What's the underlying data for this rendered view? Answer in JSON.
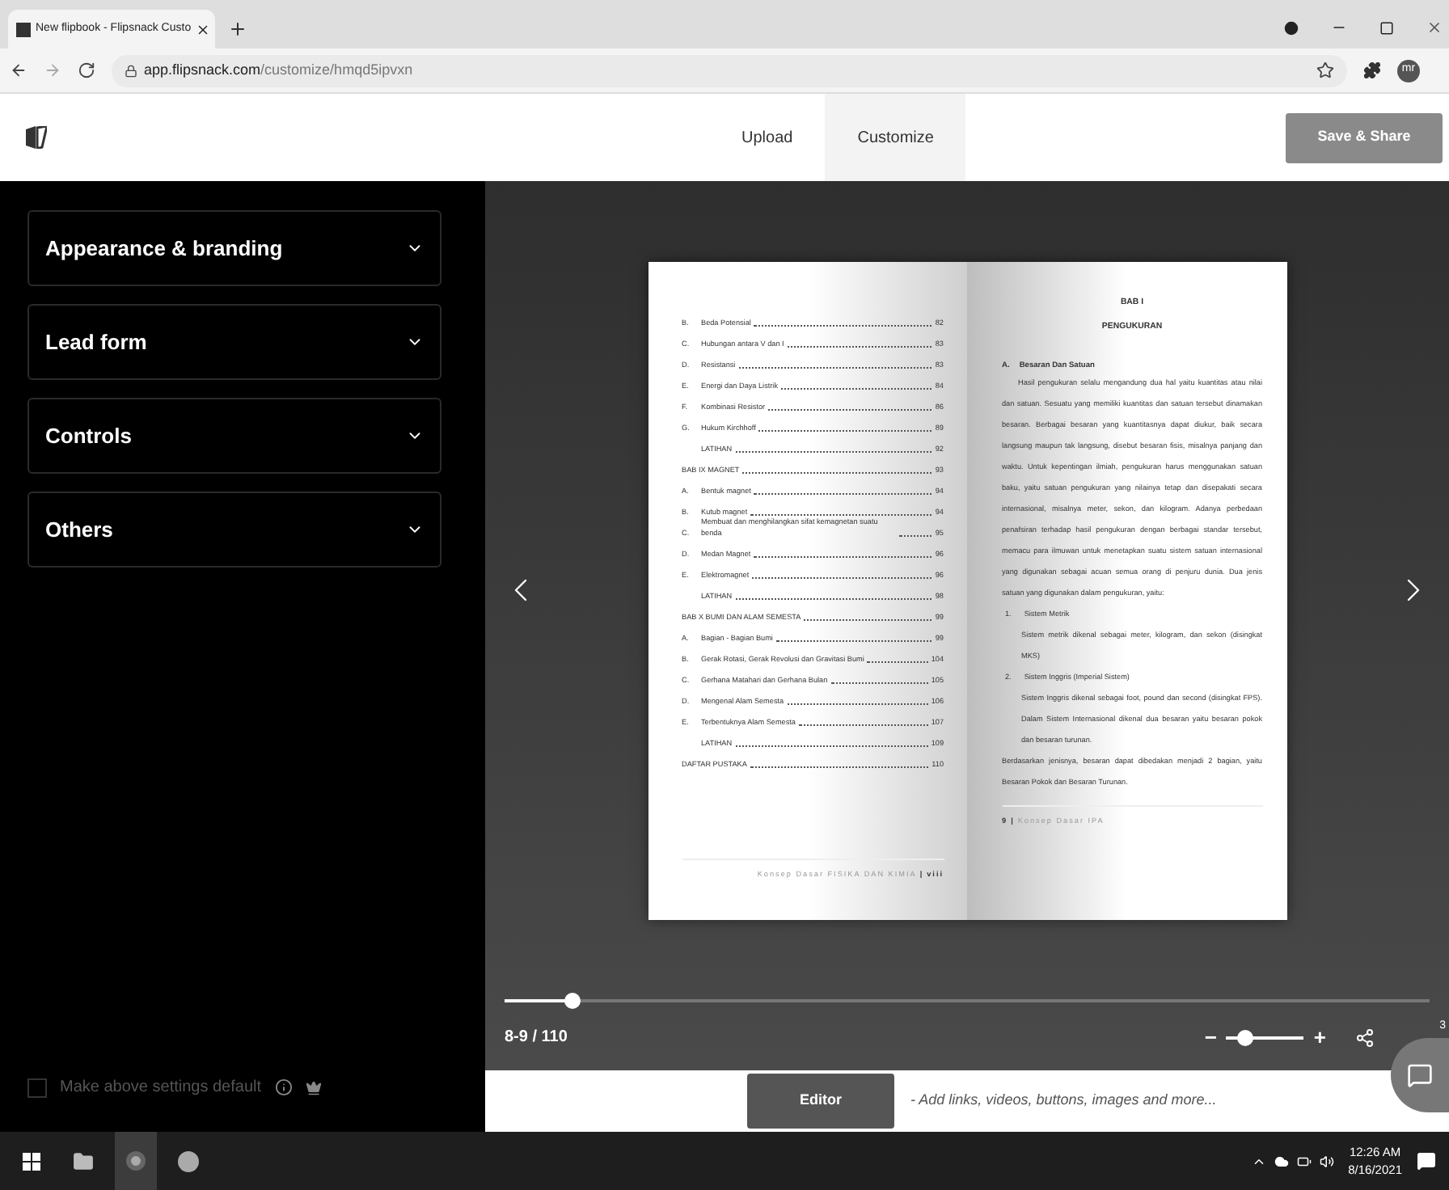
{
  "browser": {
    "tab_title": "New flipbook - Flipsnack Custo",
    "url_host": "app.flipsnack.com",
    "url_path": "/customize/hmqd5ipvxn",
    "avatar": "mr"
  },
  "header": {
    "nav": [
      {
        "label": "Upload",
        "selected": false
      },
      {
        "label": "Customize",
        "selected": true
      }
    ],
    "save_button": "Save & Share"
  },
  "sidebar": {
    "sections": [
      {
        "title": "Appearance & branding"
      },
      {
        "title": "Lead form"
      },
      {
        "title": "Controls"
      },
      {
        "title": "Others"
      }
    ],
    "default_setting": {
      "label": "Make above settings default",
      "checked": false
    }
  },
  "book": {
    "left_page": {
      "toc": [
        {
          "kind": "item",
          "letter": "B.",
          "title": "Beda Potensial",
          "page": "82"
        },
        {
          "kind": "item",
          "letter": "C.",
          "title": "Hubungan antara V dan I",
          "page": "83"
        },
        {
          "kind": "item",
          "letter": "D.",
          "title": "Resistansi",
          "page": "83"
        },
        {
          "kind": "item",
          "letter": "E.",
          "title": "Energi dan Daya Listrik",
          "page": "84"
        },
        {
          "kind": "item",
          "letter": "F.",
          "title": "Kombinasi Resistor",
          "page": "86"
        },
        {
          "kind": "item",
          "letter": "G.",
          "title": "Hukum Kirchhoff",
          "page": "89"
        },
        {
          "kind": "section",
          "title": "LATIHAN",
          "page": "92"
        },
        {
          "kind": "chapter",
          "title": "BAB IX MAGNET",
          "page": "93"
        },
        {
          "kind": "item",
          "letter": "A.",
          "title": "Bentuk magnet",
          "page": "94"
        },
        {
          "kind": "item",
          "letter": "B.",
          "title": "Kutub magnet",
          "page": "94"
        },
        {
          "kind": "item",
          "letter": "C.",
          "title": "Membuat dan menghilangkan sifat kemagnetan suatu benda",
          "page": "95"
        },
        {
          "kind": "item",
          "letter": "D.",
          "title": "Medan Magnet",
          "page": "96"
        },
        {
          "kind": "item",
          "letter": "E.",
          "title": "Elektromagnet",
          "page": "96"
        },
        {
          "kind": "section",
          "title": "LATIHAN",
          "page": "98"
        },
        {
          "kind": "chapter",
          "title": "BAB X BUMI DAN ALAM SEMESTA",
          "page": "99"
        },
        {
          "kind": "item",
          "letter": "A.",
          "title": "Bagian - Bagian Bumi",
          "page": "99"
        },
        {
          "kind": "item",
          "letter": "B.",
          "title": "Gerak Rotasi, Gerak Revolusi dan Gravitasi Bumi",
          "page": "104"
        },
        {
          "kind": "item",
          "letter": "C.",
          "title": "Gerhana Matahari dan Gerhana Bulan",
          "page": "105"
        },
        {
          "kind": "item",
          "letter": "D.",
          "title": "Mengenal Alam Semesta",
          "page": "106"
        },
        {
          "kind": "item",
          "letter": "E.",
          "title": "Terbentuknya Alam Semesta",
          "page": "107"
        },
        {
          "kind": "section",
          "title": "LATIHAN",
          "page": "109"
        },
        {
          "kind": "chapter",
          "title": "DAFTAR PUSTAKA",
          "page": "110"
        }
      ],
      "footer_title": "Konsep Dasar FISIKA DAN KIMIA",
      "footer_separator": "|",
      "footer_page": "viii"
    },
    "right_page": {
      "chapter": "BAB I",
      "chapter_title": "PENGUKURAN",
      "blocks": [
        {
          "kind": "heading",
          "letter": "A.",
          "text": "Besaran Dan Satuan"
        },
        {
          "kind": "paragraph",
          "text": "Hasil pengukuran selalu mengandung dua hal yaitu kuantitas atau nilai dan satuan. Sesuatu yang memiliki kuantitas dan satuan tersebut dinamakan besaran. Berbagai besaran yang kuantitasnya dapat diukur, baik secara langsung maupun tak langsung, disebut besaran fisis, misalnya panjang dan waktu. Untuk kepentingan ilmiah, pengukuran harus menggunakan satuan baku, yaitu satuan pengukuran yang nilainya tetap dan disepakati secara internasional, misalnya meter, sekon, dan kilogram. Adanya perbedaan penafsiran terhadap hasil pengukuran dengan berbagai standar tersebut, memacu para ilmuwan untuk menetapkan suatu sistem satuan internasional yang digunakan sebagai acuan semua orang di penjuru dunia. Dua jenis satuan yang digunakan dalam pengukuran, yaitu:"
        },
        {
          "kind": "list_item",
          "number": "1.",
          "text": "Sistem Metrik"
        },
        {
          "kind": "list_text",
          "text": "Sistem metrik dikenal sebagai meter, kilogram, dan sekon (disingkat MKS)"
        },
        {
          "kind": "list_item",
          "number": "2.",
          "text": "Sistem Inggris (Imperial Sistem)"
        },
        {
          "kind": "list_text",
          "text": "Sistem Inggris dikenal sebagai foot, pound dan second (disingkat FPS). Dalam Sistem Internasional dikenal dua besaran yaitu besaran pokok dan besaran turunan."
        },
        {
          "kind": "plain",
          "text": "Berdasarkan jenisnya, besaran dapat dibedakan menjadi 2 bagian, yaitu Besaran Pokok dan Besaran Turunan."
        }
      ],
      "footer_page": "9",
      "footer_separator": "|",
      "footer_title": "Konsep Dasar IPA"
    }
  },
  "player": {
    "progress": {
      "level": 0.074
    },
    "page_indicator": "8-9 / 110",
    "zoom": {
      "level": 0.25
    },
    "minus": "−",
    "plus": "+"
  },
  "chat": {
    "badge": "3"
  },
  "editor_bar": {
    "button": "Editor",
    "hint": "- Add links, videos, buttons, images and more..."
  },
  "taskbar": {
    "time": "12:26 AM",
    "date": "8/16/2021"
  }
}
